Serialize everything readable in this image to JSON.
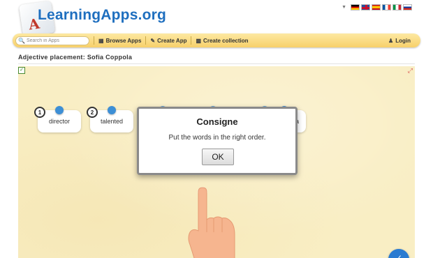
{
  "header": {
    "logo_text": "LearningApps.org"
  },
  "flags": [
    "german-flag",
    "british-flag",
    "spanish-flag",
    "french-flag",
    "italian-flag",
    "russian-flag"
  ],
  "nav": {
    "search_placeholder": "Search in Apps",
    "browse_label": "Browse Apps",
    "create_app_label": "Create App",
    "create_collection_label": "Create collection",
    "login_label": "Login"
  },
  "page": {
    "title": "Adjective placement: Sofia Coppola"
  },
  "exercise": {
    "cards": [
      {
        "number": "1",
        "text": "director"
      },
      {
        "number": "2",
        "text": "talented"
      },
      {
        "number": "",
        "text": ""
      },
      {
        "number": "",
        "text": ""
      },
      {
        "number": "",
        "text": ""
      },
      {
        "number": "",
        "text": "a"
      }
    ]
  },
  "dialog": {
    "title": "Consigne",
    "message": "Put the words in the right order.",
    "ok_label": "OK"
  },
  "colors": {
    "nav_bar": "#f7d06a",
    "app_background": "#f9eec4",
    "accent_blue": "#3d8fd6",
    "logo_blue": "#1f6fbf"
  }
}
